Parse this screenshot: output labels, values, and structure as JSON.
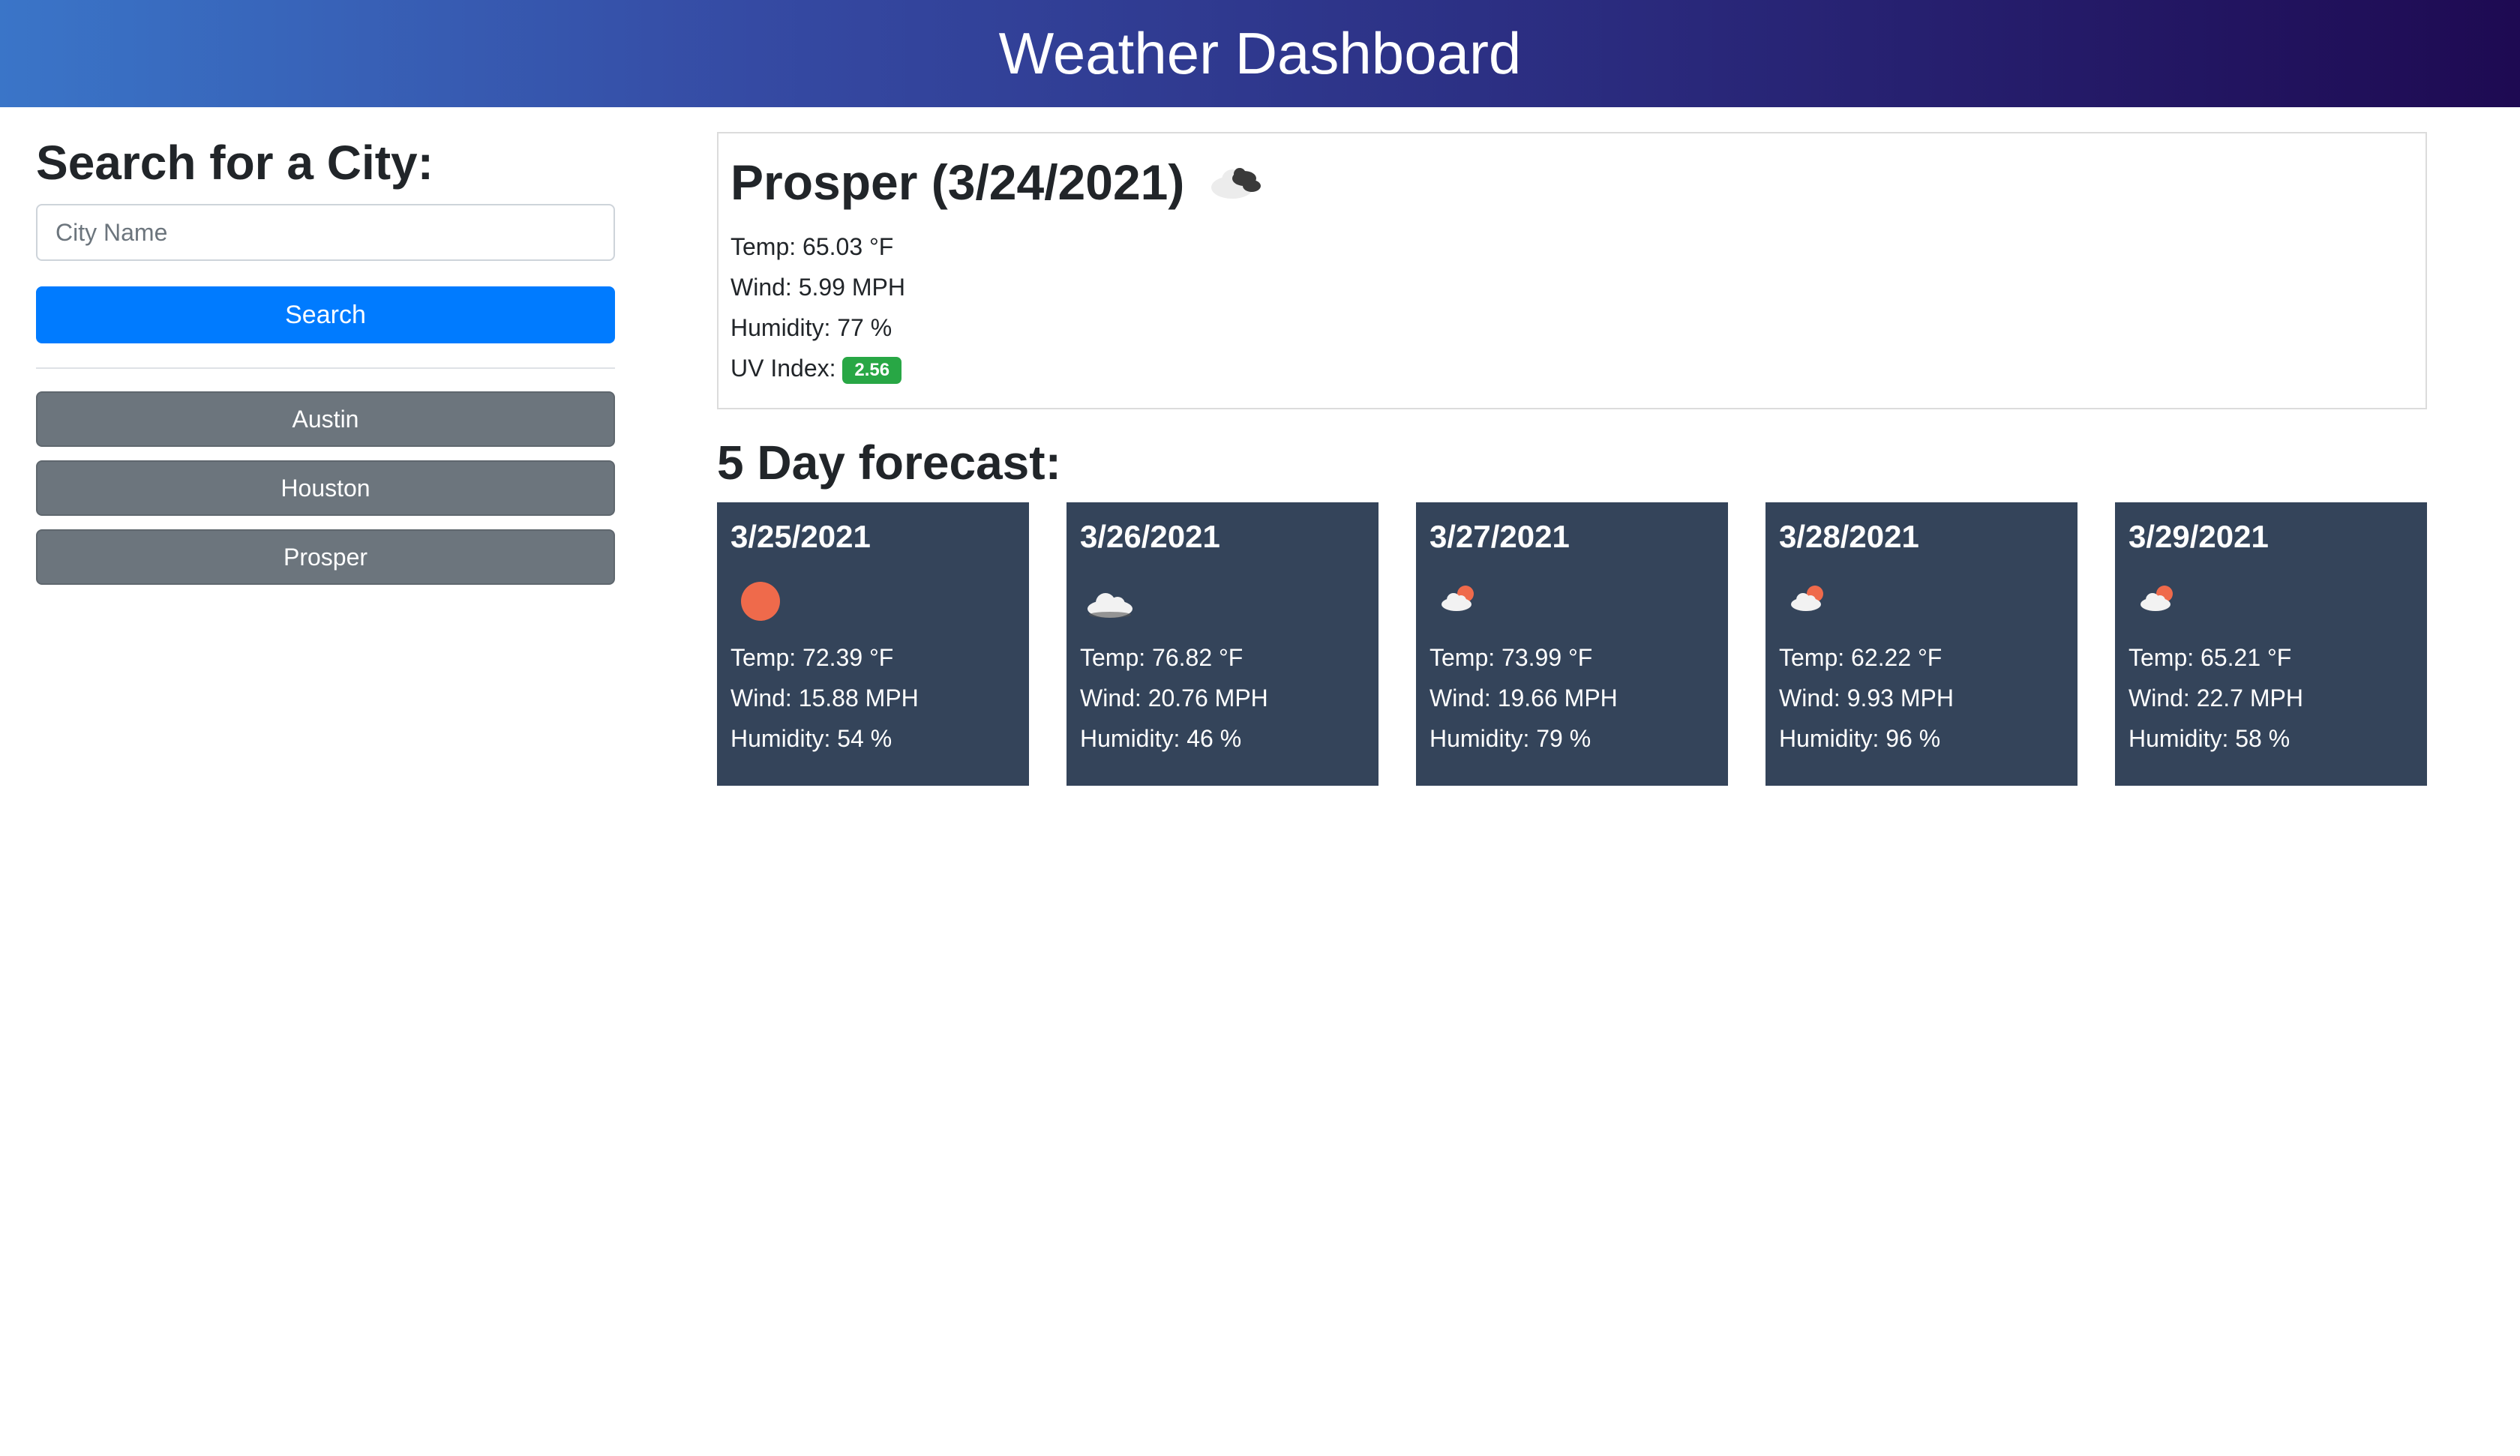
{
  "header": {
    "title": "Weather Dashboard"
  },
  "search": {
    "heading": "Search for a City:",
    "placeholder": "City Name",
    "button_label": "Search"
  },
  "history": [
    "Austin",
    "Houston",
    "Prosper"
  ],
  "current": {
    "title": "Prosper (3/24/2021)",
    "icon": "broken-clouds-icon",
    "temp": "Temp: 65.03 °F",
    "wind": "Wind: 5.99 MPH",
    "humidity": "Humidity: 77 %",
    "uv_label": "UV Index:",
    "uv_value": "2.56",
    "uv_color": "#28a745"
  },
  "forecast": {
    "heading": "5 Day forecast:",
    "days": [
      {
        "date": "3/25/2021",
        "icon": "sun-icon",
        "temp": "Temp: 72.39 °F",
        "wind": "Wind: 15.88 MPH",
        "humidity": "Humidity: 54 %"
      },
      {
        "date": "3/26/2021",
        "icon": "cloud-icon",
        "temp": "Temp: 76.82 °F",
        "wind": "Wind: 20.76 MPH",
        "humidity": "Humidity: 46 %"
      },
      {
        "date": "3/27/2021",
        "icon": "partly-cloudy-icon",
        "temp": "Temp: 73.99 °F",
        "wind": "Wind: 19.66 MPH",
        "humidity": "Humidity: 79 %"
      },
      {
        "date": "3/28/2021",
        "icon": "partly-cloudy-icon",
        "temp": "Temp: 62.22 °F",
        "wind": "Wind: 9.93 MPH",
        "humidity": "Humidity: 96 %"
      },
      {
        "date": "3/29/2021",
        "icon": "partly-cloudy-icon",
        "temp": "Temp: 65.21 °F",
        "wind": "Wind: 22.7 MPH",
        "humidity": "Humidity: 58 %"
      }
    ]
  },
  "colors": {
    "primary": "#007bff",
    "secondary": "#6c757d",
    "card_bg": "#34445a",
    "sun": "#ef6a4b"
  }
}
